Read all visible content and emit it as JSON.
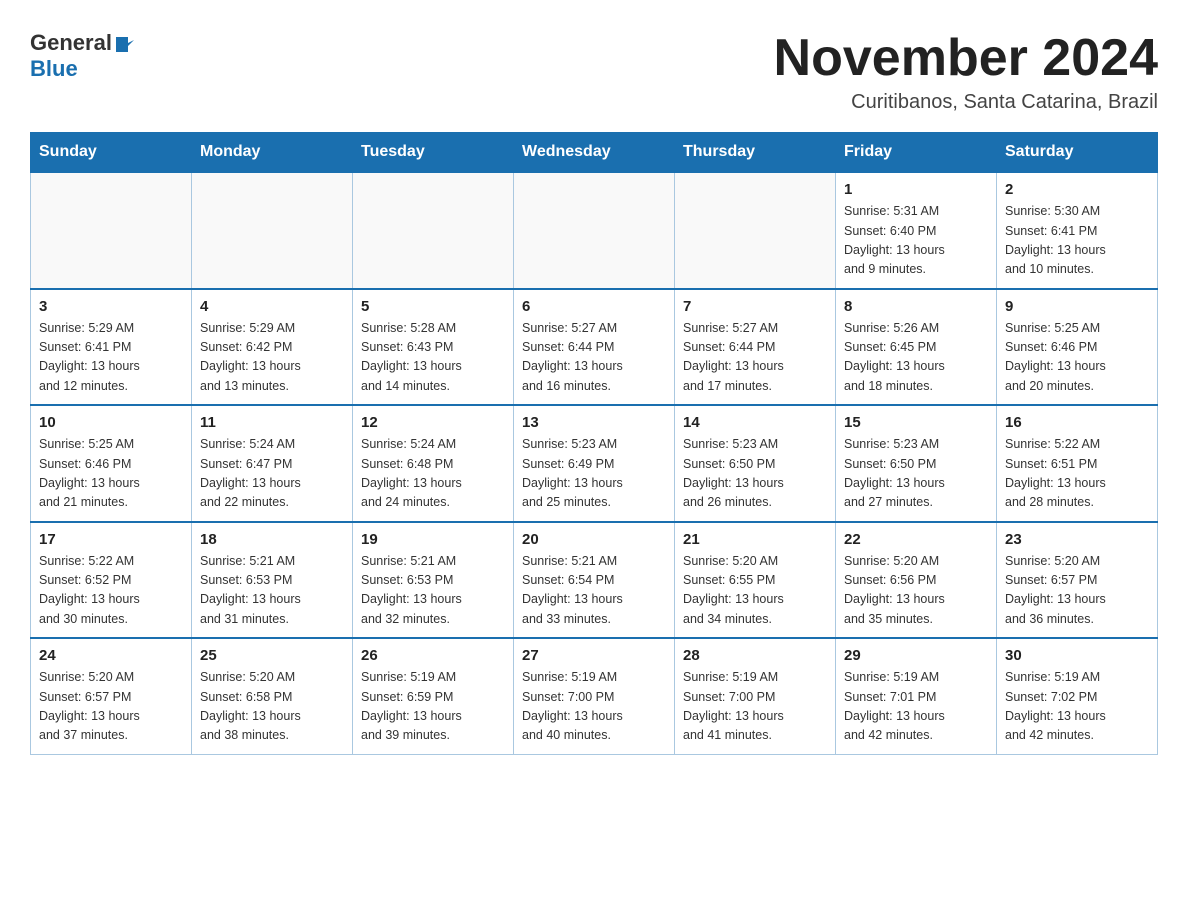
{
  "header": {
    "logo_general": "General",
    "logo_blue": "Blue",
    "title": "November 2024",
    "subtitle": "Curitibanos, Santa Catarina, Brazil"
  },
  "days_of_week": [
    "Sunday",
    "Monday",
    "Tuesday",
    "Wednesday",
    "Thursday",
    "Friday",
    "Saturday"
  ],
  "weeks": [
    [
      {
        "day": "",
        "info": ""
      },
      {
        "day": "",
        "info": ""
      },
      {
        "day": "",
        "info": ""
      },
      {
        "day": "",
        "info": ""
      },
      {
        "day": "",
        "info": ""
      },
      {
        "day": "1",
        "info": "Sunrise: 5:31 AM\nSunset: 6:40 PM\nDaylight: 13 hours\nand 9 minutes."
      },
      {
        "day": "2",
        "info": "Sunrise: 5:30 AM\nSunset: 6:41 PM\nDaylight: 13 hours\nand 10 minutes."
      }
    ],
    [
      {
        "day": "3",
        "info": "Sunrise: 5:29 AM\nSunset: 6:41 PM\nDaylight: 13 hours\nand 12 minutes."
      },
      {
        "day": "4",
        "info": "Sunrise: 5:29 AM\nSunset: 6:42 PM\nDaylight: 13 hours\nand 13 minutes."
      },
      {
        "day": "5",
        "info": "Sunrise: 5:28 AM\nSunset: 6:43 PM\nDaylight: 13 hours\nand 14 minutes."
      },
      {
        "day": "6",
        "info": "Sunrise: 5:27 AM\nSunset: 6:44 PM\nDaylight: 13 hours\nand 16 minutes."
      },
      {
        "day": "7",
        "info": "Sunrise: 5:27 AM\nSunset: 6:44 PM\nDaylight: 13 hours\nand 17 minutes."
      },
      {
        "day": "8",
        "info": "Sunrise: 5:26 AM\nSunset: 6:45 PM\nDaylight: 13 hours\nand 18 minutes."
      },
      {
        "day": "9",
        "info": "Sunrise: 5:25 AM\nSunset: 6:46 PM\nDaylight: 13 hours\nand 20 minutes."
      }
    ],
    [
      {
        "day": "10",
        "info": "Sunrise: 5:25 AM\nSunset: 6:46 PM\nDaylight: 13 hours\nand 21 minutes."
      },
      {
        "day": "11",
        "info": "Sunrise: 5:24 AM\nSunset: 6:47 PM\nDaylight: 13 hours\nand 22 minutes."
      },
      {
        "day": "12",
        "info": "Sunrise: 5:24 AM\nSunset: 6:48 PM\nDaylight: 13 hours\nand 24 minutes."
      },
      {
        "day": "13",
        "info": "Sunrise: 5:23 AM\nSunset: 6:49 PM\nDaylight: 13 hours\nand 25 minutes."
      },
      {
        "day": "14",
        "info": "Sunrise: 5:23 AM\nSunset: 6:50 PM\nDaylight: 13 hours\nand 26 minutes."
      },
      {
        "day": "15",
        "info": "Sunrise: 5:23 AM\nSunset: 6:50 PM\nDaylight: 13 hours\nand 27 minutes."
      },
      {
        "day": "16",
        "info": "Sunrise: 5:22 AM\nSunset: 6:51 PM\nDaylight: 13 hours\nand 28 minutes."
      }
    ],
    [
      {
        "day": "17",
        "info": "Sunrise: 5:22 AM\nSunset: 6:52 PM\nDaylight: 13 hours\nand 30 minutes."
      },
      {
        "day": "18",
        "info": "Sunrise: 5:21 AM\nSunset: 6:53 PM\nDaylight: 13 hours\nand 31 minutes."
      },
      {
        "day": "19",
        "info": "Sunrise: 5:21 AM\nSunset: 6:53 PM\nDaylight: 13 hours\nand 32 minutes."
      },
      {
        "day": "20",
        "info": "Sunrise: 5:21 AM\nSunset: 6:54 PM\nDaylight: 13 hours\nand 33 minutes."
      },
      {
        "day": "21",
        "info": "Sunrise: 5:20 AM\nSunset: 6:55 PM\nDaylight: 13 hours\nand 34 minutes."
      },
      {
        "day": "22",
        "info": "Sunrise: 5:20 AM\nSunset: 6:56 PM\nDaylight: 13 hours\nand 35 minutes."
      },
      {
        "day": "23",
        "info": "Sunrise: 5:20 AM\nSunset: 6:57 PM\nDaylight: 13 hours\nand 36 minutes."
      }
    ],
    [
      {
        "day": "24",
        "info": "Sunrise: 5:20 AM\nSunset: 6:57 PM\nDaylight: 13 hours\nand 37 minutes."
      },
      {
        "day": "25",
        "info": "Sunrise: 5:20 AM\nSunset: 6:58 PM\nDaylight: 13 hours\nand 38 minutes."
      },
      {
        "day": "26",
        "info": "Sunrise: 5:19 AM\nSunset: 6:59 PM\nDaylight: 13 hours\nand 39 minutes."
      },
      {
        "day": "27",
        "info": "Sunrise: 5:19 AM\nSunset: 7:00 PM\nDaylight: 13 hours\nand 40 minutes."
      },
      {
        "day": "28",
        "info": "Sunrise: 5:19 AM\nSunset: 7:00 PM\nDaylight: 13 hours\nand 41 minutes."
      },
      {
        "day": "29",
        "info": "Sunrise: 5:19 AM\nSunset: 7:01 PM\nDaylight: 13 hours\nand 42 minutes."
      },
      {
        "day": "30",
        "info": "Sunrise: 5:19 AM\nSunset: 7:02 PM\nDaylight: 13 hours\nand 42 minutes."
      }
    ]
  ]
}
